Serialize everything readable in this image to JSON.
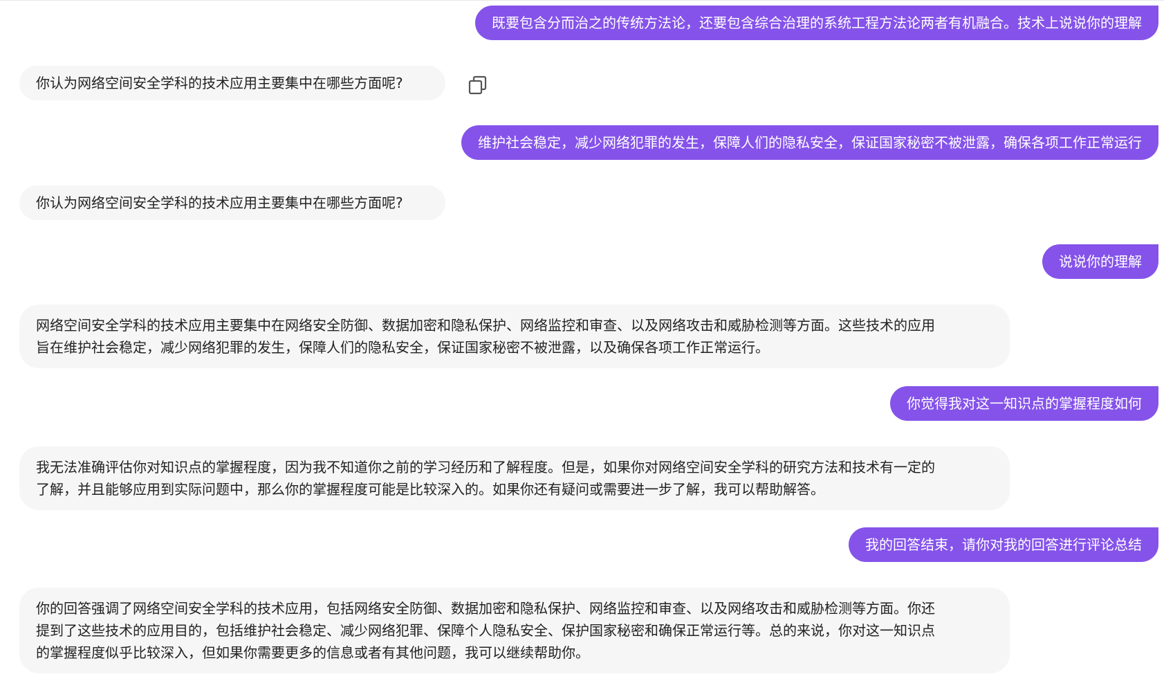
{
  "messages": [
    {
      "role": "user",
      "text": "既要包含分而治之的传统方法论，还要包含综合治理的系统工程方法论两者有机融合。技术上说说你的理解"
    },
    {
      "role": "assistant",
      "text": "你认为网络空间安全学科的技术应用主要集中在哪些方面呢?"
    },
    {
      "role": "user",
      "text": "维护社会稳定，减少网络犯罪的发生，保障人们的隐私安全，保证国家秘密不被泄露，确保各项工作正常运行"
    },
    {
      "role": "assistant",
      "text": "你认为网络空间安全学科的技术应用主要集中在哪些方面呢?"
    },
    {
      "role": "user",
      "text": "说说你的理解"
    },
    {
      "role": "assistant",
      "lines": [
        "网络空间安全学科的技术应用主要集中在网络安全防御、数据加密和隐私保护、网络监控和审查、以及网络攻击和威胁检测等方面。这些技术的应用",
        "旨在维护社会稳定，减少网络犯罪的发生，保障人们的隐私安全，保证国家秘密不被泄露，以及确保各项工作正常运行。"
      ]
    },
    {
      "role": "user",
      "text": "你觉得我对这一知识点的掌握程度如何"
    },
    {
      "role": "assistant",
      "lines": [
        "我无法准确评估你对知识点的掌握程度，因为我不知道你之前的学习经历和了解程度。但是，如果你对网络空间安全学科的研究方法和技术有一定的",
        "了解，并且能够应用到实际问题中，那么你的掌握程度可能是比较深入的。如果你还有疑问或需要进一步了解，我可以帮助解答。"
      ]
    },
    {
      "role": "user",
      "text": "我的回答结束，请你对我的回答进行评论总结"
    },
    {
      "role": "assistant",
      "lines": [
        "你的回答强调了网络空间安全学科的技术应用，包括网络安全防御、数据加密和隐私保护、网络监控和审查、以及网络攻击和威胁检测等方面。你还",
        "提到了这些技术的应用目的，包括维护社会稳定、减少网络犯罪、保障个人隐私安全、保护国家秘密和确保正常运行等。总的来说，你对这一知识点",
        "的掌握程度似乎比较深入，但如果你需要更多的信息或者有其他问题，我可以继续帮助你。"
      ]
    }
  ],
  "icons": {
    "copy": "copy-icon"
  },
  "colors": {
    "user_bubble": "#8553ea",
    "assistant_bubble": "#f6f6f6"
  }
}
